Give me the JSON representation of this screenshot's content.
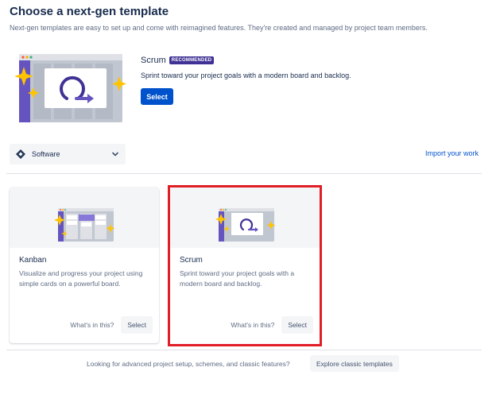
{
  "header": {
    "title": "Choose a next-gen template",
    "subtitle": "Next-gen templates are easy to set up and come with reimagined features. They're created and managed by project team members."
  },
  "featured": {
    "name": "Scrum",
    "badge": "RECOMMENDED",
    "description": "Sprint toward your project goals with a modern board and backlog.",
    "select_label": "Select",
    "illustration_icon": "scrum-loop-icon"
  },
  "filter": {
    "selected": "Software",
    "icon": "jira-software-icon",
    "import_label": "Import your work"
  },
  "cards": [
    {
      "title": "Kanban",
      "description": "Visualize and progress your project using simple cards on a powerful board.",
      "whats_label": "What's in this?",
      "select_label": "Select",
      "illustration_icon": "kanban-board-icon"
    },
    {
      "title": "Scrum",
      "description": "Sprint toward your project goals with a modern board and backlog.",
      "whats_label": "What's in this?",
      "select_label": "Select",
      "illustration_icon": "scrum-loop-icon"
    }
  ],
  "footer": {
    "text": "Looking for advanced project setup, schemes, and classic features?",
    "button_label": "Explore classic templates"
  },
  "colors": {
    "primary": "#0052cc",
    "badge": "#403294",
    "highlight": "#e01e26",
    "sparkle": "#ffc400",
    "purple": "#6554c0"
  }
}
